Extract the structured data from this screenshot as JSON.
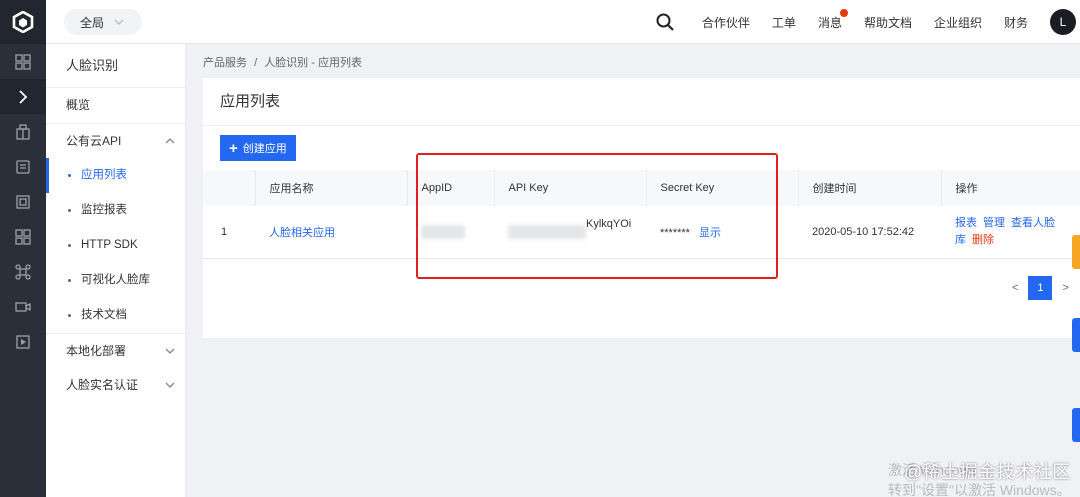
{
  "scope": {
    "label": "全局"
  },
  "topnav": {
    "items": [
      {
        "label": "合作伙伴"
      },
      {
        "label": "工单"
      },
      {
        "label": "消息",
        "has_dot": true
      },
      {
        "label": "帮助文档"
      },
      {
        "label": "企业组织"
      },
      {
        "label": "财务"
      }
    ],
    "avatar": "L"
  },
  "rail_icons": [
    "dashboard-icon",
    "expand-icon",
    "product-icon",
    "document-icon",
    "face-icon",
    "grid-icon",
    "network-icon",
    "video-icon",
    "play-icon"
  ],
  "sidebar": {
    "title": "人脸识别",
    "overview": "概览",
    "public_cloud": {
      "label": "公有云API",
      "items": [
        {
          "label": "应用列表",
          "active": true
        },
        {
          "label": "监控报表"
        },
        {
          "label": "HTTP SDK"
        },
        {
          "label": "可视化人脸库"
        },
        {
          "label": "技术文档"
        }
      ]
    },
    "local_deploy": "本地化部署",
    "realname": "人脸实名认证"
  },
  "breadcrumb": {
    "root": "产品服务",
    "sep": "/",
    "current": "人脸识别 - 应用列表"
  },
  "panel": {
    "title": "应用列表",
    "create_button": "创建应用",
    "columns": [
      "",
      "应用名称",
      "AppID",
      "API Key",
      "Secret Key",
      "创建时间",
      "操作"
    ],
    "rows": [
      {
        "index": "1",
        "name": "人脸相关应用",
        "api_key_tail": "KylkqYOi",
        "secret_mask": "*******",
        "secret_show": "显示",
        "created": "2020-05-10 17:52:42",
        "ops": {
          "report": "报表",
          "manage": "管理",
          "facelib": "查看人脸库",
          "delete": "删除"
        }
      }
    ],
    "pager": {
      "prev": "<",
      "current": "1",
      "next": ">"
    }
  },
  "overlay": {
    "win_hint": "激活 Windows\n转到\"设置\"以激活 Windows。",
    "watermark": "@稀土掘金技术社区"
  },
  "colors": {
    "primary": "#2468f2",
    "danger": "#e8380d",
    "highlight": "#e02020",
    "rail": "#2b2f3a"
  }
}
